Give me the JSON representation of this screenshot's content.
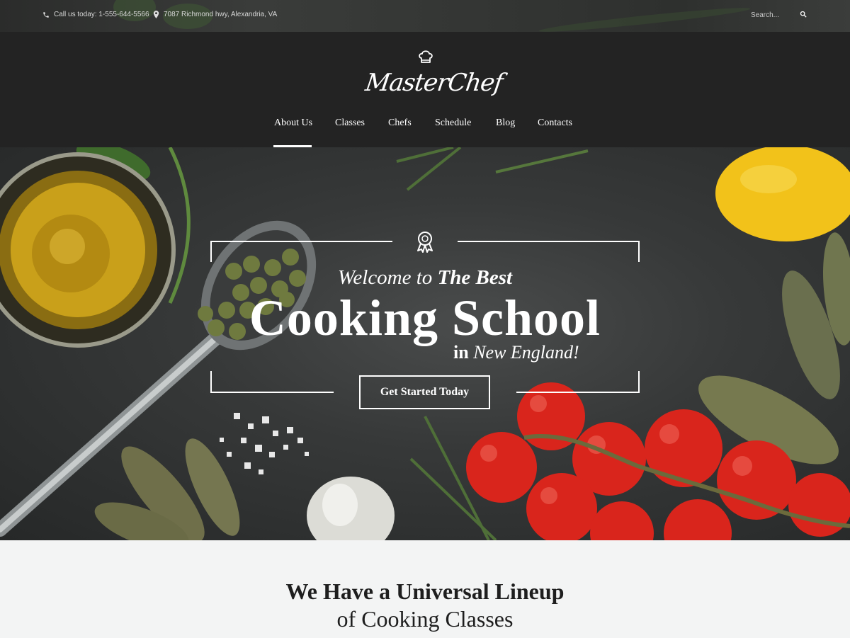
{
  "topbar": {
    "phone": "Call us today: 1-555-644-5566",
    "address": "7087 Richmond hwy, Alexandria, VA",
    "search_placeholder": "Search..."
  },
  "header": {
    "logo_text": "MasterChef",
    "nav": [
      {
        "label": "About Us",
        "active": true
      },
      {
        "label": "Classes"
      },
      {
        "label": "Chefs"
      },
      {
        "label": "Schedule"
      },
      {
        "label": "Blog"
      },
      {
        "label": "Contacts"
      }
    ]
  },
  "hero": {
    "welcome_prefix": "Welcome to",
    "welcome_bold": "The Best",
    "title": "Cooking School",
    "sub_in": "in",
    "sub_place": "New England!",
    "cta_label": "Get Started Today"
  },
  "intro": {
    "title_bold": "We Have a Universal Lineup",
    "title_light": "of Cooking Classes"
  },
  "colors": {
    "header_bg": "#232323",
    "hero_bg": "#373939",
    "tomato": "#d9251c",
    "lemon": "#f2c21a",
    "oil": "#c9a01a",
    "section_bg": "#f3f4f4"
  }
}
